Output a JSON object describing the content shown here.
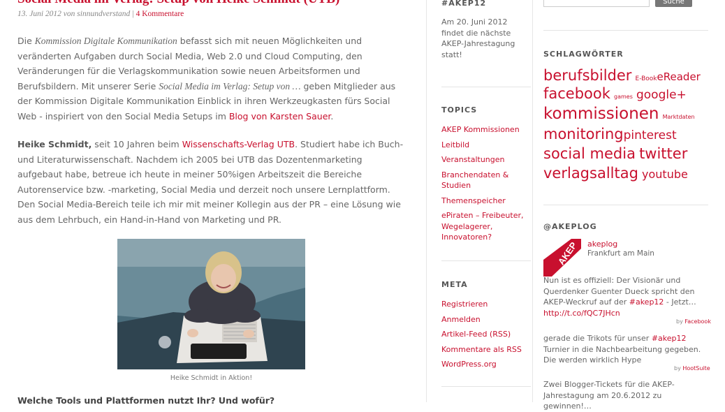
{
  "post": {
    "title": "Social Media im Verlag: Setup von Heike Schmidt (UTB)",
    "date_author": "13. Juni 2012 von sinnundverstand",
    "sep": "|",
    "comments": "4 Kommentare",
    "p1": {
      "t1": "Die ",
      "em1": "Kommission Digitale Kommunikation",
      "t2": " befasst sich mit neuen Möglichkeiten und veränderten Aufgaben durch Social Media, Web 2.0 und Cloud Computing, den Veränderungen für die Verlagskommunikation sowie neuen Arbeitsformen und Berufsbildern. Mit unserer Serie ",
      "em2": "Social Media im Verlag: Setup von …",
      "t3": " geben Mitglieder aus der Kommission Digitale Kommunikation Einblick in ihren Werkzeugkasten fürs Social Web - inspiriert von den Social Media Setups im ",
      "link": "Blog von Karsten Sauer",
      "t4": "."
    },
    "p2": {
      "strong": "Heike Schmidt,",
      "t1": " seit 10 Jahren beim ",
      "link": "Wissenschafts-Verlag UTB",
      "t2": ". Studiert habe ich Buch- und Literaturwissenschaft. Nachdem ich 2005 bei UTB das Dozentenmarketing aufgebaut habe, betreue ich heute in meiner 50%igen Arbeitszeit die Bereiche Autorenservice bzw. -marketing, Social Media und derzeit noch unsere Lernplattform. Den Social Media-Bereich teile ich mir mit meiner Kollegin aus der PR – eine Lösung wie aus dem Lehrbuch, ein Hand-in-Hand von Marketing und PR."
    },
    "photo_caption": "Heike Schmidt in Aktion!",
    "next_heading": "Welche Tools und Plattformen nutzt Ihr? Und wofür?"
  },
  "akep12": {
    "title": "#AKEP12",
    "text": "Am 20. Juni 2012 findet die nächste AKEP-Jahrestagung statt!"
  },
  "topics": {
    "title": "TOPICS",
    "items": [
      "AKEP Kommissionen",
      "Leitbild",
      "Veranstaltungen",
      "Branchendaten & Studien",
      "Themenspeicher",
      "ePiraten – Freibeuter, Wegelagerer, Innovatoren?"
    ]
  },
  "meta": {
    "title": "META",
    "items": [
      "Registrieren",
      "Anmelden",
      "Artikel-Feed (RSS)",
      "Kommentare als RSS",
      "WordPress.org"
    ]
  },
  "search": {
    "button": "Suche"
  },
  "tags": {
    "title": "SCHLAGWÖRTER",
    "items": [
      "berufsbilder",
      "E-Book",
      "eReader",
      "facebook",
      "games",
      "google+",
      "kommissionen",
      "Marktdaten",
      "monitoring",
      "pinterest",
      "social media",
      "twitter",
      "verlagsalltag",
      "youtube"
    ]
  },
  "twitter": {
    "title": "@AKEPLOG",
    "handle": "akeplog",
    "location": "Frankfurt am Main",
    "logo_text": "AKEP",
    "tweets": [
      {
        "pre": "Nun ist es offiziell: Der Visionär und Querdenker Guenter Dueck spricht den AKEP-Weckruf auf der ",
        "tag": "#akep12",
        "post": " - Jetzt…",
        "link": "http://t.co/fQC7JHcn",
        "by": "by",
        "via": "Facebook"
      },
      {
        "pre": "gerade die Trikots für unser ",
        "tag": "#akep12",
        "post": " Turnier in die Nachbearbeitung gegeben. Die werden wirklich Hype",
        "by": "by",
        "via": "HootSuite"
      },
      {
        "pre": "Zwei Blogger-Tickets für die AKEP-Jahrestagung am 20.6.2012 zu gewinnen!…"
      }
    ]
  },
  "colors": {
    "accent": "#c8102e",
    "text": "#666666",
    "divider": "#e4e4e4"
  }
}
